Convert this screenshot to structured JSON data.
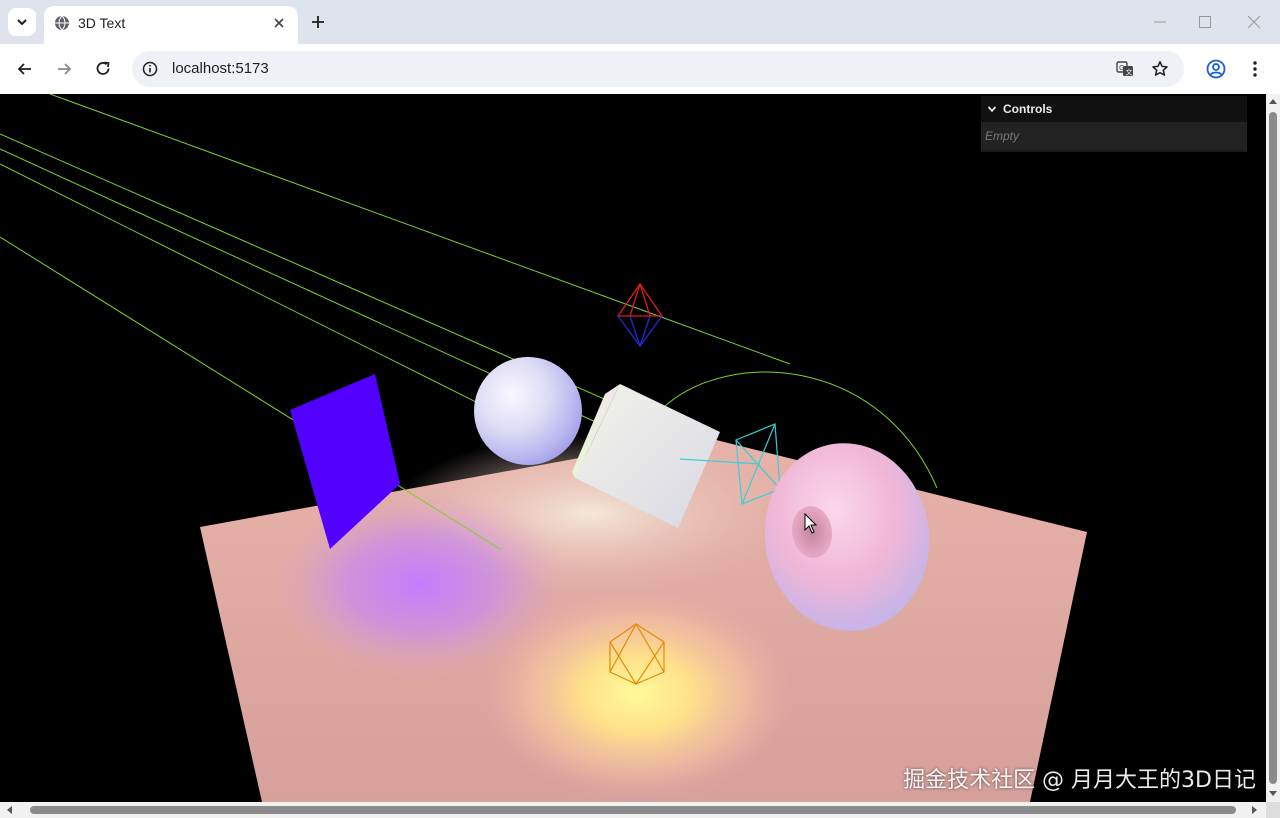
{
  "browser": {
    "tab_title": "3D Text",
    "url": "localhost:5173",
    "icons": {
      "tab_menu": "chevron-down-icon",
      "favicon": "globe-icon",
      "close": "close-icon",
      "new_tab": "plus-icon",
      "back": "back-arrow-icon",
      "forward": "forward-arrow-icon",
      "reload": "reload-icon",
      "site_info": "info-icon",
      "translate": "translate-icon",
      "bookmark": "star-icon",
      "profile": "profile-icon",
      "menu": "kebab-menu-icon"
    }
  },
  "gui": {
    "title": "Controls",
    "empty_text": "Empty"
  },
  "watermark": "掘金技术社区 @ 月月大王的3D日记"
}
